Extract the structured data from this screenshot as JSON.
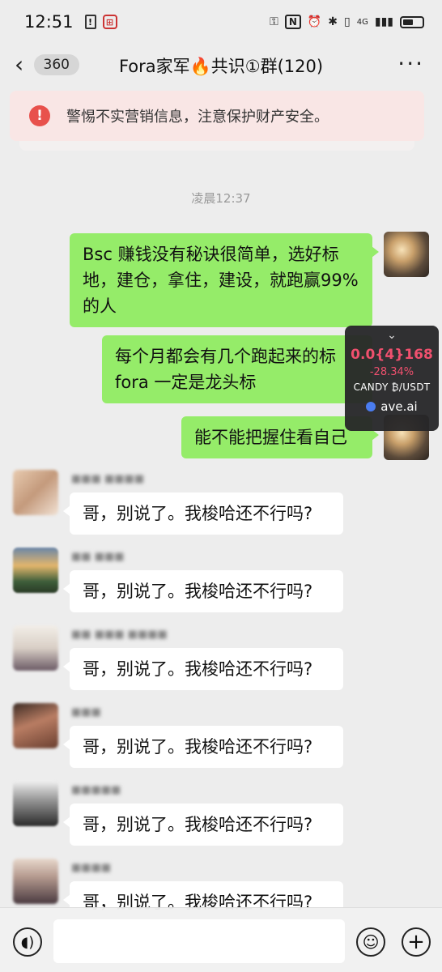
{
  "status_bar": {
    "time": "12:51",
    "icons": [
      "alert-icon",
      "app-icon",
      "key-icon",
      "nfc-icon",
      "alarm-icon",
      "bluetooth-icon",
      "vibrate-icon",
      "network-4g-icon",
      "signal-icon",
      "battery-icon"
    ],
    "network": "4G"
  },
  "header": {
    "back_count": "360",
    "title": "Fora家军🔥共识①群(120)",
    "more": "···"
  },
  "warning": {
    "text": "警惕不实营销信息，注意保护财产安全。"
  },
  "time_divider": "凌晨12:37",
  "messages": [
    {
      "side": "me",
      "text": "Bsc 赚钱没有秘诀很简单，选好标地，建仓，拿住，建设，就跑赢99% 的人"
    },
    {
      "side": "me",
      "text": "每个月都会有几个跑起来的标fora 一定是龙头标"
    },
    {
      "side": "me",
      "text": "能不能把握住看自己"
    },
    {
      "side": "other",
      "text": "哥，别说了。我梭哈还不行吗?"
    },
    {
      "side": "other",
      "text": "哥，别说了。我梭哈还不行吗?"
    },
    {
      "side": "other",
      "text": "哥，别说了。我梭哈还不行吗?"
    },
    {
      "side": "other",
      "text": "哥，别说了。我梭哈还不行吗?"
    },
    {
      "side": "other",
      "text": "哥，别说了。我梭哈还不行吗?"
    },
    {
      "side": "other",
      "text": "哥，别说了。我梭哈还不行吗?"
    }
  ],
  "overlay": {
    "chevron": "⌄",
    "price": "0.0{4}168",
    "change": "-28.34%",
    "pair": "CANDY ₿/USDT",
    "brand": "ave.ai"
  },
  "input_bar": {
    "placeholder": ""
  }
}
